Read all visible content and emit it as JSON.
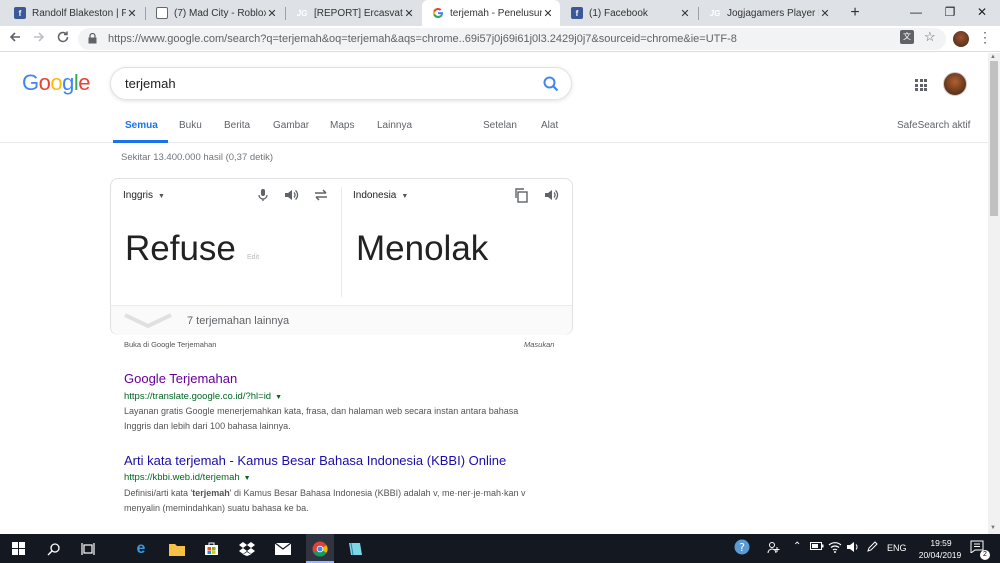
{
  "browser": {
    "tabs": [
      {
        "title": "Randolf Blakeston | Faceb",
        "favicon": "facebook-icon"
      },
      {
        "title": "(7) Mad City - Roblox",
        "favicon": "roblox-icon"
      },
      {
        "title": "[REPORT] Ercasvatolum",
        "favicon": "jogjagamers-icon"
      },
      {
        "title": "terjemah - Penelusuran G",
        "favicon": "google-icon"
      },
      {
        "title": "(1) Facebook",
        "favicon": "facebook-icon"
      },
      {
        "title": "Jogjagamers Player Pane",
        "favicon": "jogjagamers-icon"
      }
    ],
    "active_tab": 3,
    "url": "https://www.google.com/search?q=terjemah&oq=terjemah&aqs=chrome..69i57j0j69i61j0l3.2429j0j7&sourceid=chrome&ie=UTF-8",
    "favicon_text_fb": "f",
    "favicon_text_jg": "JG",
    "new_tab_label": "+",
    "minimize_label": "—",
    "maximize_label": "❐",
    "close_label": "✕"
  },
  "google": {
    "logo_letters": [
      "G",
      "o",
      "o",
      "g",
      "l",
      "e"
    ],
    "logo_colors": [
      "#4285f4",
      "#ea4335",
      "#fbbc05",
      "#4285f4",
      "#34a853",
      "#ea4335"
    ],
    "query": "terjemah",
    "nav_tabs": [
      "Semua",
      "Buku",
      "Berita",
      "Gambar",
      "Maps",
      "Lainnya"
    ],
    "selected_tab": "Semua",
    "settings_label": "Setelan",
    "tools_label": "Alat",
    "safesearch_label": "SafeSearch aktif",
    "result_stats": "Sekitar 13.400.000 hasil (0,37 detik)"
  },
  "translate": {
    "source_lang": "Inggris",
    "target_lang": "Indonesia",
    "source_text": "Refuse",
    "edit_label": "Edit",
    "target_text": "Menolak",
    "more_label": "7 terjemahan lainnya",
    "open_label": "Buka di Google Terjemahan",
    "feedback_label": "Masukan"
  },
  "results": [
    {
      "title": "Google Terjemahan",
      "url": "https://translate.google.co.id/?hl=id",
      "desc_line1": "Layanan gratis Google menerjemahkan kata, frasa, dan halaman web secara instan antara bahasa",
      "desc_line2": "Inggris dan lebih dari 100 bahasa lainnya.",
      "visited": true
    },
    {
      "title": "Arti kata terjemah - Kamus Besar Bahasa Indonesia (KBBI) Online",
      "url": "https://kbbi.web.id/terjemah",
      "desc_pre": "Definisi/arti kata '",
      "desc_bold": "terjemah",
      "desc_post": "' di Kamus Besar Bahasa Indonesia (KBBI) adalah v, me·ner·je·mah·kan v",
      "desc_line2": "menyalin (memindahkan) suatu bahasa ke ba.",
      "visited": false
    }
  ],
  "taskbar": {
    "language": "ENG",
    "time": "19:59",
    "date": "20/04/2019",
    "notifications": "2",
    "accent_color": "#8fb8ff"
  }
}
